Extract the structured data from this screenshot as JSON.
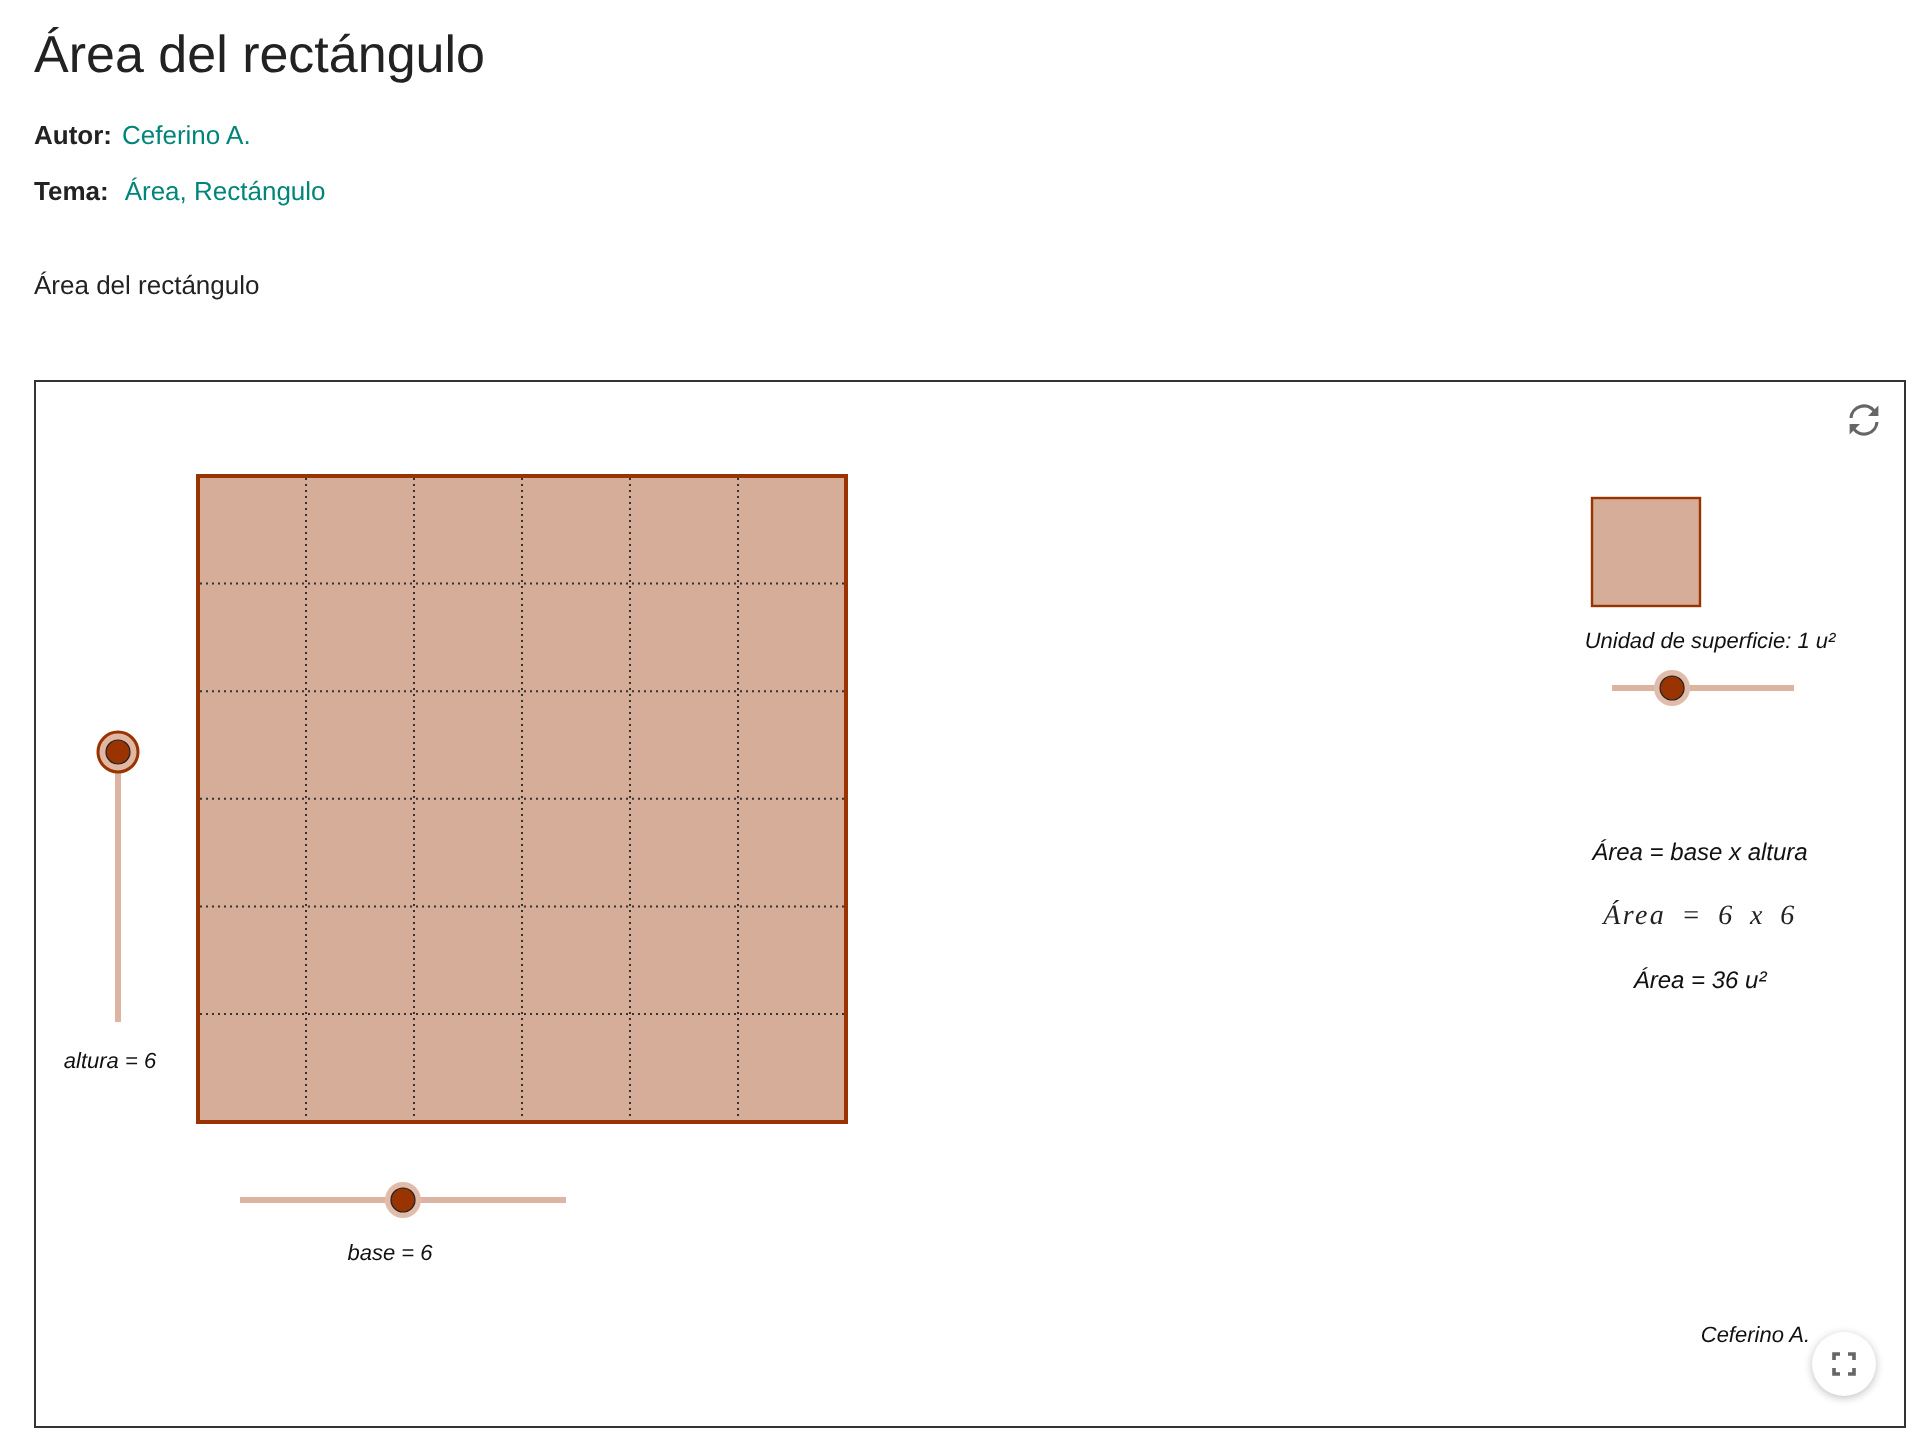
{
  "page": {
    "title": "Área del rectángulo",
    "author": {
      "label": "Autor:",
      "name": "Ceferino A."
    },
    "topic": {
      "label": "Tema:",
      "value": "Área, Rectángulo"
    },
    "description": "Área del rectángulo"
  },
  "applet": {
    "altura_slider": {
      "label": "altura = 6",
      "level": 1,
      "selected": true
    },
    "base_slider": {
      "label": "base = 6",
      "level": 0.5,
      "selected": false
    },
    "unit": {
      "label": "Unidad de superficie: 1 u²",
      "slider": {
        "level": 0.33,
        "selected": false
      }
    },
    "formulas": [
      {
        "kind": "plain",
        "text": "Área = base x altura"
      },
      {
        "kind": "math",
        "text": "Área = 6 x 6"
      },
      {
        "kind": "plain",
        "text": "Área = 36 u²"
      }
    ],
    "credit": "Ceferino A."
  }
}
